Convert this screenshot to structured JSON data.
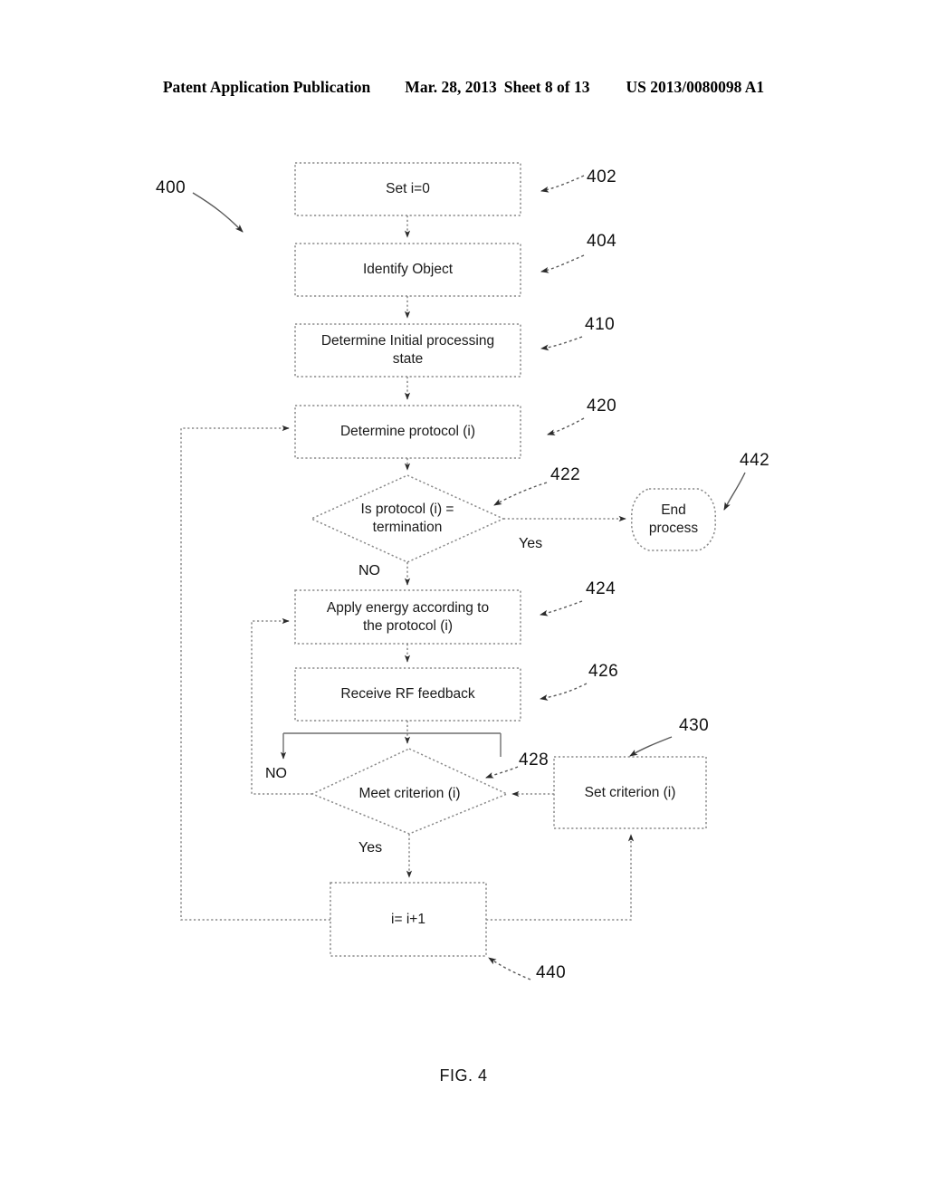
{
  "header": {
    "publication": "Patent Application Publication",
    "date": "Mar. 28, 2013",
    "sheet": "Sheet 8 of 13",
    "doc_number": "US 2013/0080098 A1"
  },
  "figure": {
    "caption": "FIG. 4",
    "diagram_ref": "400"
  },
  "nodes": {
    "set_i": {
      "label": "Set i=0",
      "ref": "402"
    },
    "identify_object": {
      "label": "Identify Object",
      "ref": "404"
    },
    "determine_initial_state": {
      "label": "Determine Initial processing\nstate",
      "ref": "410"
    },
    "determine_protocol": {
      "label": "Determine  protocol  (i)",
      "ref": "420"
    },
    "is_termination": {
      "label": "Is protocol (i) =\ntermination",
      "ref": "422"
    },
    "apply_energy": {
      "label": "Apply energy according to\nthe protocol (i)",
      "ref": "424"
    },
    "receive_feedback": {
      "label": "Receive RF feedback",
      "ref": "426"
    },
    "meet_criterion": {
      "label": "Meet criterion (i)",
      "ref": "428"
    },
    "set_criterion": {
      "label": "Set criterion (i)",
      "ref": "430"
    },
    "increment_i": {
      "label": "i= i+1",
      "ref": "440"
    },
    "end_process": {
      "label": "End\nprocess",
      "ref": "442"
    }
  },
  "edge_labels": {
    "termination_yes": "Yes",
    "termination_no": "NO",
    "criterion_yes": "Yes",
    "criterion_no": "NO"
  },
  "colors": {
    "ink": "#1a1a1a",
    "line": "#7d7d7d",
    "solid_line": "#5f5f5f",
    "background": "#ffffff"
  }
}
